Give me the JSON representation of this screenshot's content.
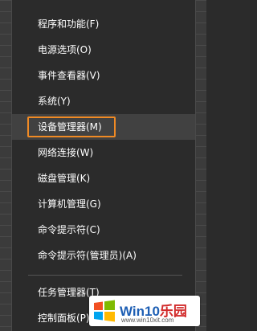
{
  "menu": {
    "items": [
      {
        "label": "程序和功能(F)"
      },
      {
        "label": "电源选项(O)"
      },
      {
        "label": "事件查看器(V)"
      },
      {
        "label": "系统(Y)"
      },
      {
        "label": "设备管理器(M)"
      },
      {
        "label": "网络连接(W)"
      },
      {
        "label": "磁盘管理(K)"
      },
      {
        "label": "计算机管理(G)"
      },
      {
        "label": "命令提示符(C)"
      },
      {
        "label": "命令提示符(管理员)(A)"
      }
    ],
    "lower_items": [
      {
        "label": "任务管理器(T)"
      },
      {
        "label": "控制面板(P)"
      }
    ],
    "highlighted_index": 4,
    "highlight_color": "#f08a24"
  },
  "watermark": {
    "brand": "Win10",
    "brand_suffix": "乐园",
    "url": "www.win10xit.com",
    "icon": "windows-logo-icon"
  }
}
